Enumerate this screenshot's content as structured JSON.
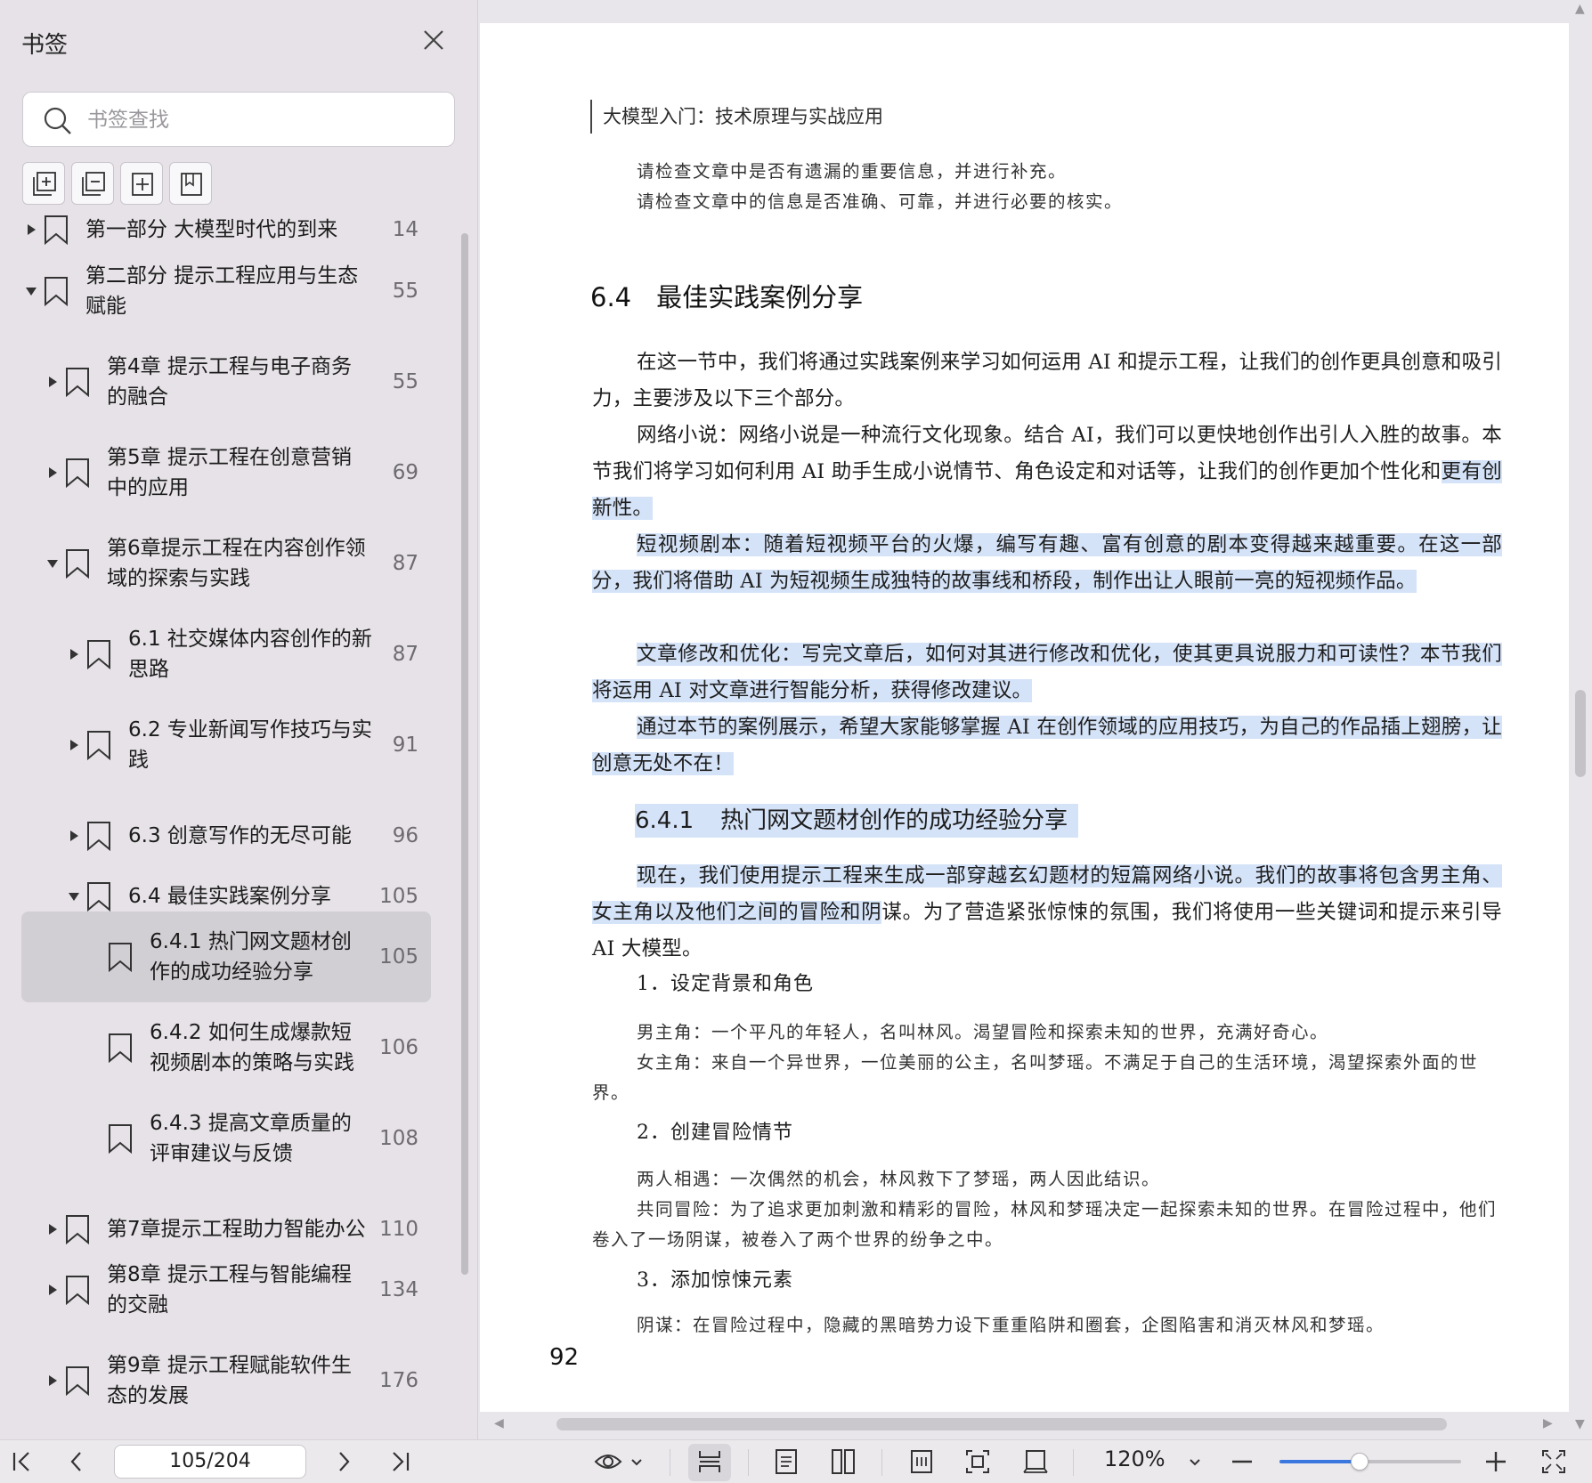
{
  "sidebar": {
    "title": "书签",
    "search_placeholder": "书签查找",
    "items": [
      {
        "lines": [
          "第一部分 大模型时代的到来"
        ],
        "page": "14"
      },
      {
        "lines": [
          "第二部分 提示工程应用与生态",
          "赋能"
        ],
        "page": "55"
      },
      {
        "lines": [
          "第4章 提示工程与电子商务",
          "的融合"
        ],
        "page": "55"
      },
      {
        "lines": [
          "第5章 提示工程在创意营销",
          "中的应用"
        ],
        "page": "69"
      },
      {
        "lines": [
          "第6章提示工程在内容创作领",
          "域的探索与实践"
        ],
        "page": "87"
      },
      {
        "lines": [
          "6.1 社交媒体内容创作的新",
          "思路"
        ],
        "page": "87"
      },
      {
        "lines": [
          "6.2 专业新闻写作技巧与实",
          "践"
        ],
        "page": "91"
      },
      {
        "lines": [
          "6.3 创意写作的无尽可能"
        ],
        "page": "96"
      },
      {
        "lines": [
          "6.4 最佳实践案例分享"
        ],
        "page": "105"
      },
      {
        "lines": [
          "6.4.1 热门网文题材创",
          "作的成功经验分享"
        ],
        "page": "105"
      },
      {
        "lines": [
          "6.4.2 如何生成爆款短",
          "视频剧本的策略与实践"
        ],
        "page": "106"
      },
      {
        "lines": [
          "6.4.3 提高文章质量的",
          "评审建议与反馈"
        ],
        "page": "108"
      },
      {
        "lines": [
          "第7章提示工程助力智能办公"
        ],
        "page": "110"
      },
      {
        "lines": [
          "第8章 提示工程与智能编程",
          "的交融"
        ],
        "page": "134"
      },
      {
        "lines": [
          "第9章 提示工程赋能软件生",
          "态的发展"
        ],
        "page": "176"
      }
    ]
  },
  "document": {
    "running_head": "大模型入门：技术原理与实战应用",
    "intro_lines": [
      "请检查文章中是否有遗漏的重要信息，并进行补充。",
      "请检查文章中的信息是否准确、可靠，并进行必要的核实。"
    ],
    "section_number": "6.4",
    "section_title": "最佳实践案例分享",
    "p1": "在这一节中，我们将通过实践案例来学习如何运用 AI 和提示工程，让我们的创作更具创意和吸引力，主要涉及以下三个部分。",
    "p2_plain": "网络小说：网络小说是一种流行文化现象。结合 AI，我们可以更快地创作出引人入胜的故事。本节我们将学习如何利用 AI 助手生成小说情节、角色设定和对话等，让我们的创作更加个性化和",
    "p2_hl": "更有创新性。",
    "p3": "短视频剧本：随着短视频平台的火爆，编写有趣、富有创意的剧本变得越来越重要。在这一部分，我们将借助 AI 为短视频生成独特的故事线和桥段，制作出让人眼前一亮的短视频作品。",
    "p4": "文章修改和优化：写完文章后，如何对其进行修改和优化，使其更具说服力和可读性？本节我们将运用 AI 对文章进行智能分析，获得修改建议。",
    "p5": "通过本节的案例展示，希望大家能够掌握 AI 在创作领域的应用技巧，为自己的作品插上翅膀，让创意无处不在！",
    "subsection_number": "6.4.1",
    "subsection_title": "热门网文题材创作的成功经验分享",
    "p6_hl": "现在，我们使用提示工程来生成一部穿越玄幻题材的短篇网络小说。我们的故事将包含男主角、女主角以及他们之间的冒险和阴",
    "p6_plain": "谋。为了营造紧张惊悚的氛围，我们将使用一些关键词和提示来引导 AI 大模型。",
    "step1": "1．设定背景和角色",
    "s1a": "男主角：一个平凡的年轻人，名叫林风。渴望冒险和探索未知的世界，充满好奇心。",
    "s1b": "女主角：来自一个异世界，一位美丽的公主，名叫梦瑶。不满足于自己的生活环境，渴望探索外面的世界。",
    "step2": "2．创建冒险情节",
    "s2a": "两人相遇：一次偶然的机会，林风救下了梦瑶，两人因此结识。",
    "s2b": "共同冒险：为了追求更加刺激和精彩的冒险，林风和梦瑶决定一起探索未知的世界。在冒险过程中，他们卷入了一场阴谋，被卷入了两个世界的纷争之中。",
    "step3": "3．添加惊悚元素",
    "s3a": "阴谋：在冒险过程中，隐藏的黑暗势力设下重重陷阱和圈套，企图陷害和消灭林风和梦瑶。",
    "page_number": "92"
  },
  "toolbar": {
    "page_indicator": "105/204",
    "zoom": "120%",
    "zoom_fraction": 0.44
  },
  "colors": {
    "highlight": "#d5e3f8",
    "accent": "#3a78e0"
  }
}
